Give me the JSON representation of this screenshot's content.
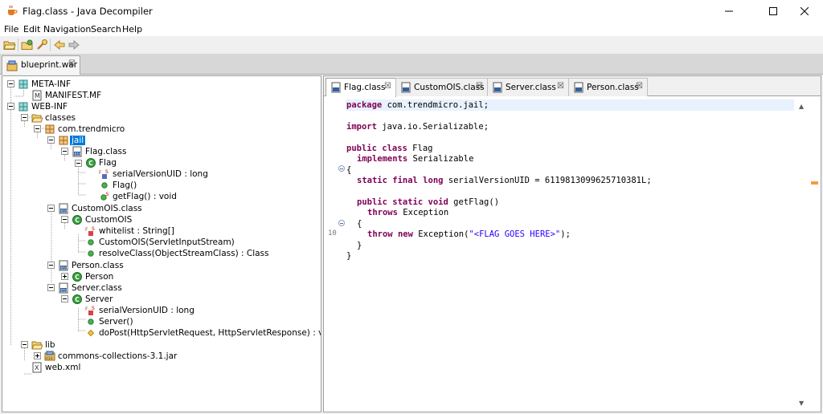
{
  "window": {
    "title": "Flag.class - Java Decompiler"
  },
  "menu": [
    "File",
    "Edit",
    "Navigation",
    "Search",
    "Help"
  ],
  "file_tab": {
    "label": "blueprint.war"
  },
  "tree": [
    {
      "label": "META-INF"
    },
    {
      "label": "MANIFEST.MF"
    },
    {
      "label": "WEB-INF"
    },
    {
      "label": "classes"
    },
    {
      "label": "com.trendmicro"
    },
    {
      "label": "jail"
    },
    {
      "label": "Flag.class"
    },
    {
      "label": "Flag"
    },
    {
      "label": "serialVersionUID : long"
    },
    {
      "label": "Flag()"
    },
    {
      "label": "getFlag() : void"
    },
    {
      "label": "CustomOIS.class"
    },
    {
      "label": "CustomOIS"
    },
    {
      "label": "whitelist : String[]"
    },
    {
      "label": "CustomOIS(ServletInputStream)"
    },
    {
      "label": "resolveClass(ObjectStreamClass) : Class"
    },
    {
      "label": "Person.class"
    },
    {
      "label": "Person"
    },
    {
      "label": "Server.class"
    },
    {
      "label": "Server"
    },
    {
      "label": "serialVersionUID : long"
    },
    {
      "label": "Server()"
    },
    {
      "label": "doPost(HttpServletRequest, HttpServletResponse) : void"
    },
    {
      "label": "lib"
    },
    {
      "label": "commons-collections-3.1.jar"
    },
    {
      "label": "web.xml"
    }
  ],
  "editor_tabs": [
    "Flag.class",
    "CustomOIS.class",
    "Server.class",
    "Person.class"
  ],
  "code": {
    "l1_kw": "package",
    "l1_rest": " com.trendmicro.jail;",
    "l2_kw": "import",
    "l2_rest": " java.io.Serializable;",
    "l3_kw": "public class",
    "l3_rest": " Flag",
    "l4_kw": "implements",
    "l4_rest": " Serializable",
    "l5": "{",
    "l6_kw": "static final long",
    "l6_rest": " serialVersionUID = 6119813099625710381L;",
    "l7_kw": "public static void",
    "l7_rest": " getFlag()",
    "l8_kw": "throws",
    "l8_rest": " Exception",
    "l9": "{",
    "l10_kw1": "throw",
    "l10_kw2": "new",
    "l10_a": " Exception(",
    "l10_str": "\"<FLAG GOES HERE>\"",
    "l10_b": ");",
    "l11": "}",
    "l12": "}"
  },
  "line_number": "10"
}
